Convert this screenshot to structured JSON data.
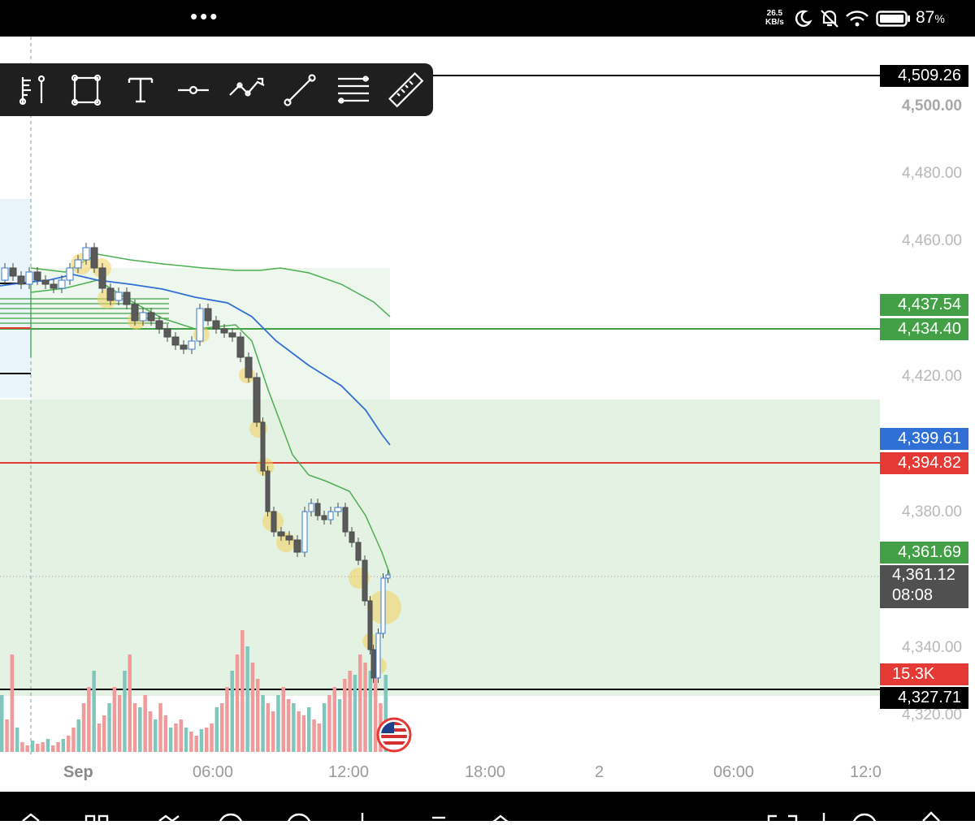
{
  "status_bar": {
    "dots": "•••",
    "net_speed_value": "26.5",
    "net_speed_unit": "KB/s",
    "battery_percent": "87",
    "battery_unit": "%",
    "icons": [
      "moon-icon",
      "bell-off-icon",
      "wifi-icon",
      "battery-icon"
    ]
  },
  "toolbar": {
    "tools": [
      "price-range-icon",
      "rectangle-icon",
      "text-icon",
      "horizontal-line-icon",
      "path-icon",
      "trend-line-icon",
      "fib-lines-icon",
      "ruler-icon"
    ]
  },
  "price_axis": {
    "ticks": [
      "4,500.00",
      "4,480.00",
      "4,460.00",
      "4,420.00",
      "4,380.00",
      "4,340.00",
      "4,320.00"
    ]
  },
  "price_labels": {
    "top_line": "4,509.26",
    "green_upper": "4,437.54",
    "green_lower": "4,434.40",
    "blue": "4,399.61",
    "red": "4,394.82",
    "green_current": "4,361.69",
    "last_price": "4,361.12",
    "countdown": "08:08",
    "volume": "15.3K",
    "bottom_line": "4,327.71"
  },
  "time_axis": {
    "labels": [
      "Sep",
      "06:00",
      "12:00",
      "18:00",
      "2",
      "06:00",
      "12:0"
    ]
  },
  "colors": {
    "black_line": "#000000",
    "green_line": "#43a047",
    "red_line": "#e53935",
    "blue_line": "#2f6fd6",
    "zone_fill": "#e3f2e3",
    "vol_up": "#7fc7bd",
    "vol_down": "#f09a9a"
  }
}
